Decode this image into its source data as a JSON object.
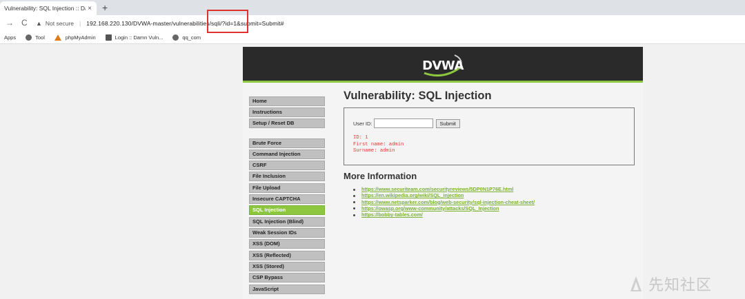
{
  "browser": {
    "tab_title": "Vulnerability: SQL Injection :: Da",
    "tab_close": "×",
    "new_tab": "+",
    "back": "←",
    "forward": "→",
    "reload": "C",
    "not_secure": "Not secure",
    "url": "192.168.220.130/DVWA-master/vulnerabilities/sqli/?id=1&submit=Submit#",
    "bookmarks": [
      {
        "label": "Apps",
        "icon": "apps-icon"
      },
      {
        "label": "Tool",
        "icon": "globe-icon"
      },
      {
        "label": "phpMyAdmin",
        "icon": "phpmyadmin-icon"
      },
      {
        "label": "Login :: Damn Vuln...",
        "icon": "page-icon"
      },
      {
        "label": "qq_com",
        "icon": "globe-icon"
      }
    ],
    "highlight_color": "#e0302b"
  },
  "dvwa": {
    "logo": "DVWA",
    "menu": [
      {
        "label": "Home"
      },
      {
        "label": "Instructions"
      },
      {
        "label": "Setup / Reset DB"
      },
      {
        "label": "Brute Force"
      },
      {
        "label": "Command Injection"
      },
      {
        "label": "CSRF"
      },
      {
        "label": "File Inclusion"
      },
      {
        "label": "File Upload"
      },
      {
        "label": "Insecure CAPTCHA"
      },
      {
        "label": "SQL Injection",
        "active": true
      },
      {
        "label": "SQL Injection (Blind)"
      },
      {
        "label": "Weak Session IDs"
      },
      {
        "label": "XSS (DOM)"
      },
      {
        "label": "XSS (Reflected)"
      },
      {
        "label": "XSS (Stored)"
      },
      {
        "label": "CSP Bypass"
      },
      {
        "label": "JavaScript"
      }
    ],
    "title": "Vulnerability: SQL Injection",
    "user_id_label": "User ID:",
    "user_id_value": "",
    "submit_label": "Submit",
    "result": {
      "id": "ID: 1",
      "first_name": "First name: admin",
      "surname": "Surname: admin"
    },
    "more_info_title": "More Information",
    "links": [
      "https://www.securiteam.com/securityreviews/5DP0N1P76E.html",
      "https://en.wikipedia.org/wiki/SQL_injection",
      "https://www.netsparker.com/blog/web-security/sql-injection-cheat-sheet/",
      "https://owasp.org/www-community/attacks/SQL_Injection",
      "https://bobby-tables.com/"
    ],
    "accent_color": "#8dc63f"
  },
  "watermark": "先知社区"
}
